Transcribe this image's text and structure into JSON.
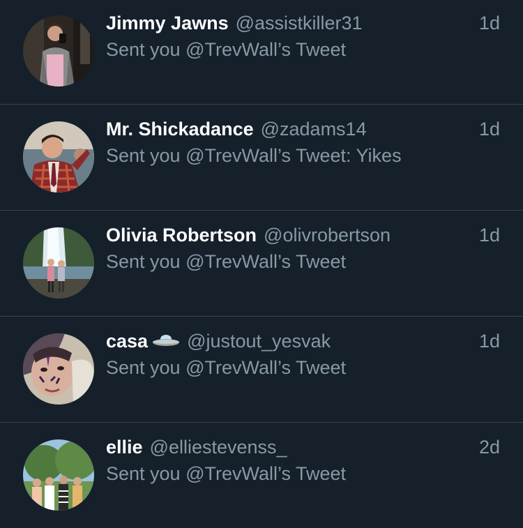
{
  "notifications": [
    {
      "name": "Jimmy Jawns",
      "handle": "@assistkiller31",
      "message": "Sent you @TrevWall’s Tweet",
      "time": "1d",
      "avatar": "mirror-selfie-avatar"
    },
    {
      "name": "Mr. Shickadance",
      "handle": "@zadams14",
      "message": "Sent you @TrevWall’s Tweet: Yikes",
      "time": "1d",
      "avatar": "plaid-suit-man-avatar"
    },
    {
      "name": "Olivia Robertson",
      "handle": "@olivrobertson",
      "message": "Sent you @TrevWall’s Tweet",
      "time": "1d",
      "avatar": "waterfall-friends-avatar"
    },
    {
      "name": "casa",
      "name_emoji": "ufo-emoji",
      "handle": "@justout_yesvak",
      "message": "Sent you @TrevWall’s Tweet",
      "time": "1d",
      "avatar": "face-paint-selfie-avatar"
    },
    {
      "name": "ellie",
      "handle": "@elliestevenss_",
      "message": "Sent you @TrevWall’s Tweet",
      "time": "2d",
      "avatar": "group-of-friends-avatar"
    }
  ],
  "colors": {
    "background": "#15202b",
    "divider": "#38444d",
    "primary_text": "#ffffff",
    "secondary_text": "#8899a6"
  }
}
